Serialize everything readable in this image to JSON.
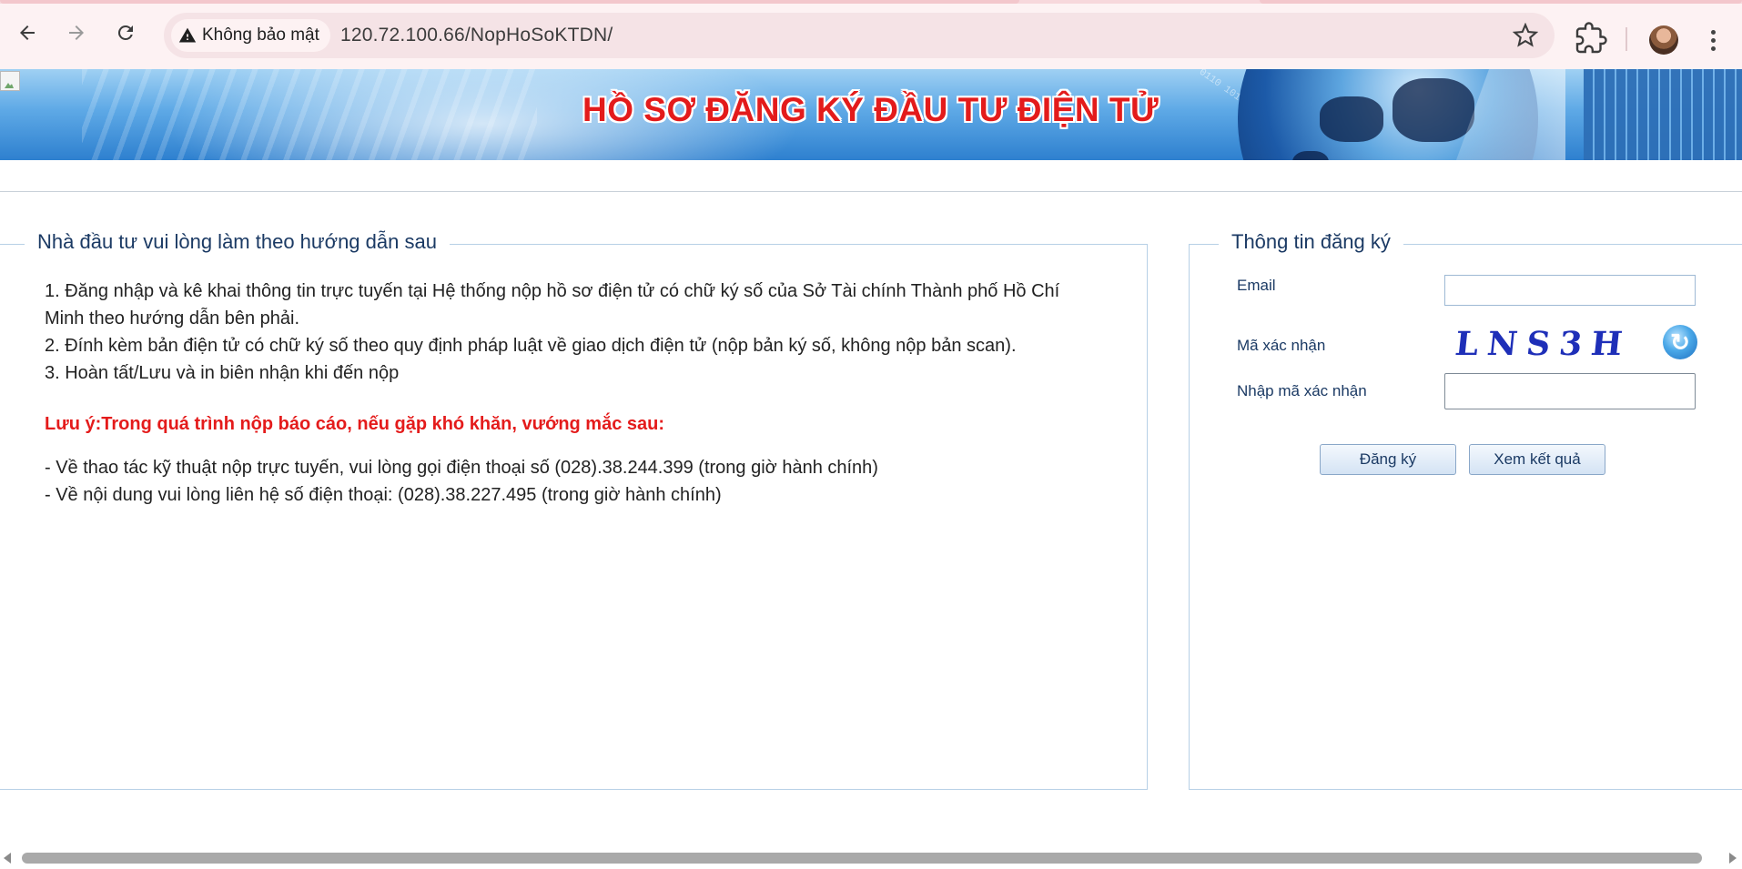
{
  "browser": {
    "security_label": "Không bảo mật",
    "url": "120.72.100.66/NopHoSoKTDN/",
    "icons": [
      "back-icon",
      "forward-icon",
      "reload-icon",
      "warning-icon",
      "star-icon",
      "extensions-icon",
      "avatar",
      "menu-icon"
    ]
  },
  "banner": {
    "title": "HỒ SƠ ĐĂNG KÝ ĐẦU TƯ ĐIỆN TỬ"
  },
  "instructions": {
    "legend": "Nhà đầu tư vui lòng làm theo hướng dẫn sau",
    "steps": [
      "1. Đăng nhập và kê khai thông tin trực tuyến tại Hệ thống nộp hồ sơ điện tử có chữ ký số của Sở Tài chính Thành phố Hồ Chí Minh theo hướng dẫn bên phải.",
      "2. Đính kèm bản điện tử có chữ ký số theo quy định pháp luật về giao dịch điện tử (nộp bản ký số, không nộp bản scan).",
      "3. Hoàn tất/Lưu và in biên nhận khi đến nộp"
    ],
    "note": "Lưu ý:Trong quá trình nộp báo cáo, nếu gặp khó khăn, vướng mắc sau:",
    "contacts": [
      "- Về thao tác kỹ thuật nộp trực tuyến, vui lòng gọi điện thoại số (028).38.244.399 (trong giờ hành chính)",
      "- Về nội dung vui lòng liên hệ số điện thoại: (028).38.227.495 (trong giờ hành chính)"
    ]
  },
  "registration": {
    "legend": "Thông tin đăng ký",
    "email_label": "Email",
    "email_value": "",
    "captcha_label": "Mã xác nhận",
    "captcha_text": "LNS3H",
    "code_label": "Nhập mã xác nhận",
    "code_value": "",
    "register_button": "Đăng ký",
    "view_result_button": "Xem kết quả"
  },
  "colors": {
    "banner_title": "#e31b1b",
    "note": "#e41b1b",
    "label": "#1b3a64",
    "captcha": "#1e2fb8"
  }
}
